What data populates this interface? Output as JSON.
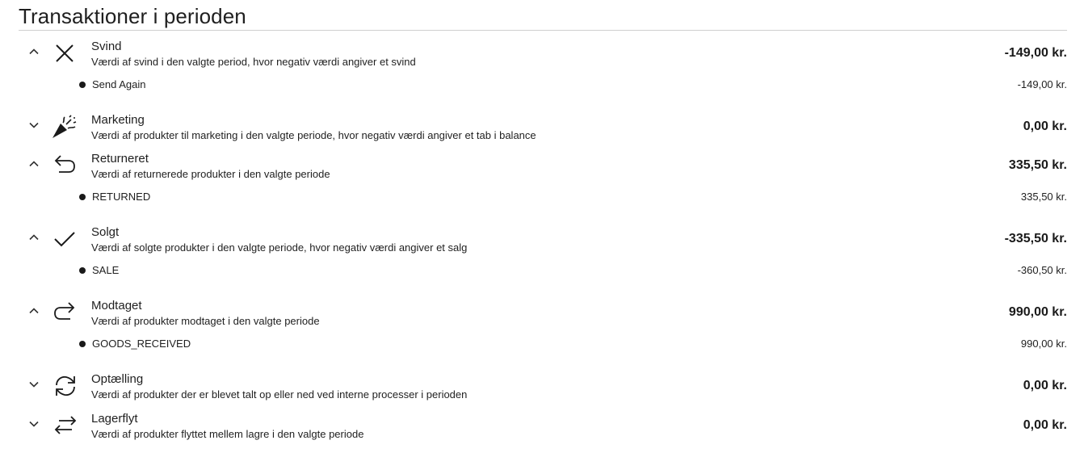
{
  "page_title": "Transaktioner i perioden",
  "transactions": [
    {
      "name": "Svind",
      "icon": "x-icon",
      "expanded": true,
      "description": "Værdi af svind i den valgte period, hvor negativ værdi angiver et svind",
      "total": "-149,00 kr.",
      "items": [
        {
          "label": "Send Again",
          "amount": "-149,00 kr."
        }
      ]
    },
    {
      "name": "Marketing",
      "icon": "party-popper-icon",
      "expanded": false,
      "description": "Værdi af produkter til marketing i den valgte periode, hvor negativ værdi angiver et tab i balance",
      "total": "0,00 kr.",
      "items": []
    },
    {
      "name": "Returneret",
      "icon": "undo-arrow-icon",
      "expanded": true,
      "description": "Værdi af returnerede produkter i den valgte periode",
      "total": "335,50 kr.",
      "items": [
        {
          "label": "RETURNED",
          "amount": "335,50 kr."
        }
      ]
    },
    {
      "name": "Solgt",
      "icon": "check-icon",
      "expanded": true,
      "description": "Værdi af solgte produkter i den valgte periode, hvor negativ værdi angiver et salg",
      "total": "-335,50 kr.",
      "items": [
        {
          "label": "SALE",
          "amount": "-360,50 kr."
        }
      ]
    },
    {
      "name": "Modtaget",
      "icon": "redo-arrow-icon",
      "expanded": true,
      "description": "Værdi af produkter modtaget i den valgte periode",
      "total": "990,00 kr.",
      "items": [
        {
          "label": "GOODS_RECEIVED",
          "amount": "990,00 kr."
        }
      ]
    },
    {
      "name": "Optælling",
      "icon": "refresh-cycle-icon",
      "expanded": false,
      "description": "Værdi af produkter der er blevet talt op eller ned ved interne processer i perioden",
      "total": "0,00 kr.",
      "items": []
    },
    {
      "name": "Lagerflyt",
      "icon": "swap-arrows-icon",
      "expanded": false,
      "description": "Værdi af produkter flyttet mellem lagre i den valgte periode",
      "total": "0,00 kr.",
      "items": []
    }
  ]
}
